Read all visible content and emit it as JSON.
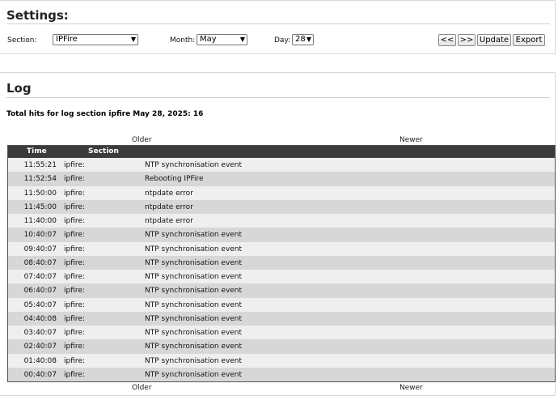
{
  "settings": {
    "title": "Settings:",
    "section_label": "Section:",
    "section_value": "IPFire",
    "month_label": "Month:",
    "month_value": "May",
    "day_label": "Day:",
    "day_value": "28",
    "buttons": {
      "prev": "<<",
      "next": ">>",
      "update": "Update",
      "export": "Export"
    }
  },
  "log": {
    "title": "Log",
    "summary": "Total hits for log section ipfire May 28, 2025: 16",
    "older": "Older",
    "newer": "Newer",
    "columns": {
      "time": "Time",
      "section": "Section"
    },
    "rows": [
      {
        "time": "11:55:21",
        "section": "ipfire:",
        "message": "NTP synchronisation event"
      },
      {
        "time": "11:52:54",
        "section": "ipfire:",
        "message": "Rebooting IPFire"
      },
      {
        "time": "11:50:00",
        "section": "ipfire:",
        "message": "ntpdate error"
      },
      {
        "time": "11:45:00",
        "section": "ipfire:",
        "message": "ntpdate error"
      },
      {
        "time": "11:40:00",
        "section": "ipfire:",
        "message": "ntpdate error"
      },
      {
        "time": "10:40:07",
        "section": "ipfire:",
        "message": "NTP synchronisation event"
      },
      {
        "time": "09:40:07",
        "section": "ipfire:",
        "message": "NTP synchronisation event"
      },
      {
        "time": "08:40:07",
        "section": "ipfire:",
        "message": "NTP synchronisation event"
      },
      {
        "time": "07:40:07",
        "section": "ipfire:",
        "message": "NTP synchronisation event"
      },
      {
        "time": "06:40:07",
        "section": "ipfire:",
        "message": "NTP synchronisation event"
      },
      {
        "time": "05:40:07",
        "section": "ipfire:",
        "message": "NTP synchronisation event"
      },
      {
        "time": "04:40:08",
        "section": "ipfire:",
        "message": "NTP synchronisation event"
      },
      {
        "time": "03:40:07",
        "section": "ipfire:",
        "message": "NTP synchronisation event"
      },
      {
        "time": "02:40:07",
        "section": "ipfire:",
        "message": "NTP synchronisation event"
      },
      {
        "time": "01:40:08",
        "section": "ipfire:",
        "message": "NTP synchronisation event"
      },
      {
        "time": "00:40:07",
        "section": "ipfire:",
        "message": "NTP synchronisation event"
      }
    ]
  }
}
